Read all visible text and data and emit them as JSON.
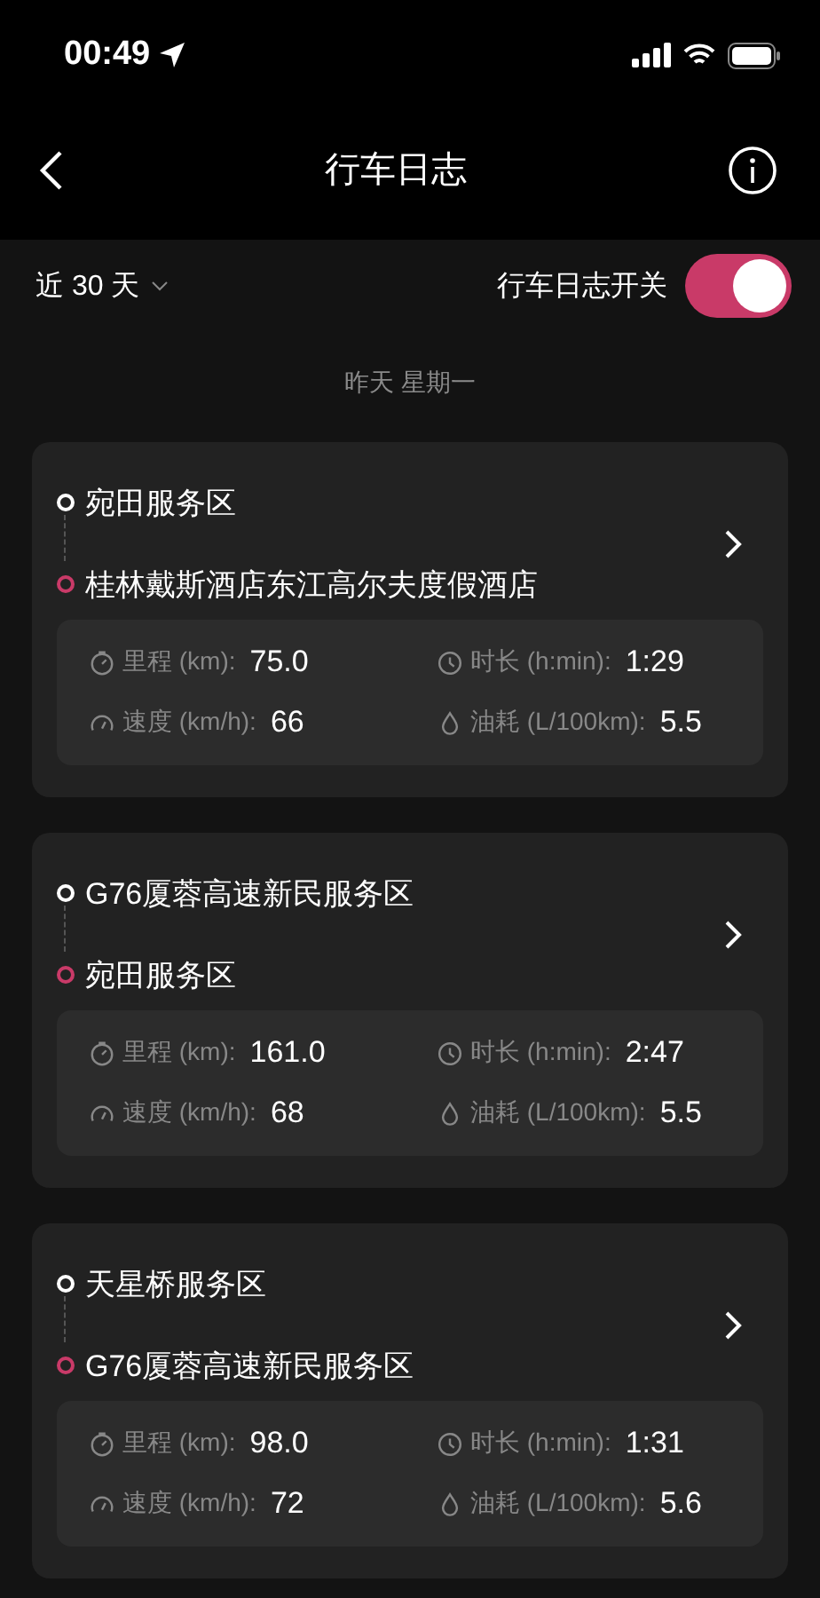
{
  "status_bar": {
    "time": "00:49"
  },
  "nav": {
    "title": "行车日志"
  },
  "filter": {
    "range": "近 30 天",
    "toggle_label": "行车日志开关",
    "toggle_on": true
  },
  "date_header": "昨天 星期一",
  "trips": [
    {
      "from": "宛田服务区",
      "to": "桂林戴斯酒店东江高尔夫度假酒店",
      "stats": [
        {
          "kind": "distance",
          "label": "里程 (km):",
          "value": "75.0"
        },
        {
          "kind": "duration",
          "label": "时长 (h:min):",
          "value": "1:29"
        },
        {
          "kind": "speed",
          "label": "速度 (km/h):",
          "value": "66"
        },
        {
          "kind": "fuel",
          "label": "油耗 (L/100km):",
          "value": "5.5"
        }
      ]
    },
    {
      "from": "G76厦蓉高速新民服务区",
      "to": "宛田服务区",
      "stats": [
        {
          "kind": "distance",
          "label": "里程 (km):",
          "value": "161.0"
        },
        {
          "kind": "duration",
          "label": "时长 (h:min):",
          "value": "2:47"
        },
        {
          "kind": "speed",
          "label": "速度 (km/h):",
          "value": "68"
        },
        {
          "kind": "fuel",
          "label": "油耗 (L/100km):",
          "value": "5.5"
        }
      ]
    },
    {
      "from": "天星桥服务区",
      "to": "G76厦蓉高速新民服务区",
      "stats": [
        {
          "kind": "distance",
          "label": "里程 (km):",
          "value": "98.0"
        },
        {
          "kind": "duration",
          "label": "时长 (h:min):",
          "value": "1:31"
        },
        {
          "kind": "speed",
          "label": "速度 (km/h):",
          "value": "72"
        },
        {
          "kind": "fuel",
          "label": "油耗 (L/100km):",
          "value": "5.6"
        }
      ]
    }
  ]
}
